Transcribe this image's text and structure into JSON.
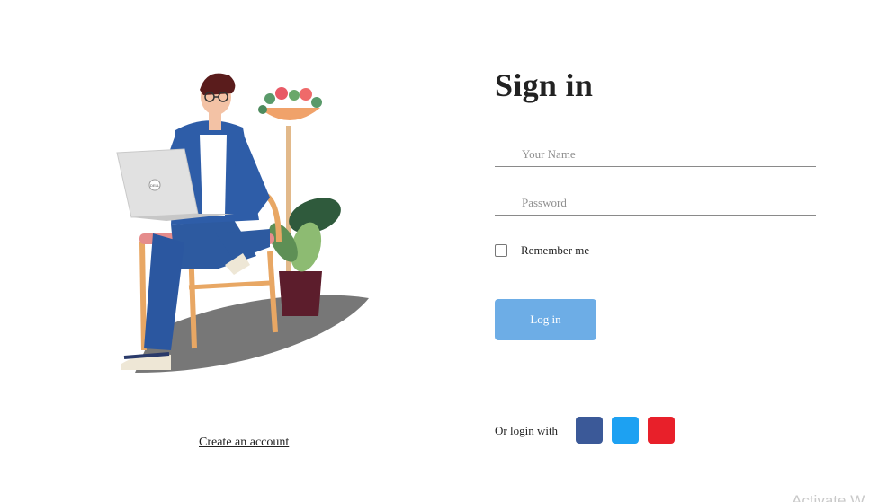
{
  "illustration": {
    "laptop_brand_label": "DELL"
  },
  "footer": {
    "create_account_label": "Create an account"
  },
  "form": {
    "title": "Sign in",
    "name_placeholder": "Your Name",
    "password_placeholder": "Password",
    "remember_label": "Remember me",
    "remember_checked": false,
    "login_label": "Log in"
  },
  "social": {
    "label": "Or login with",
    "buttons": [
      {
        "name": "facebook",
        "color": "#3b5998"
      },
      {
        "name": "twitter",
        "color": "#1da1f2"
      },
      {
        "name": "google",
        "color": "#e8202a"
      }
    ]
  },
  "watermark": {
    "text": "Activate W"
  },
  "colors": {
    "accent": "#6dade6",
    "text": "#222222",
    "placeholder": "#8f8f8f"
  }
}
